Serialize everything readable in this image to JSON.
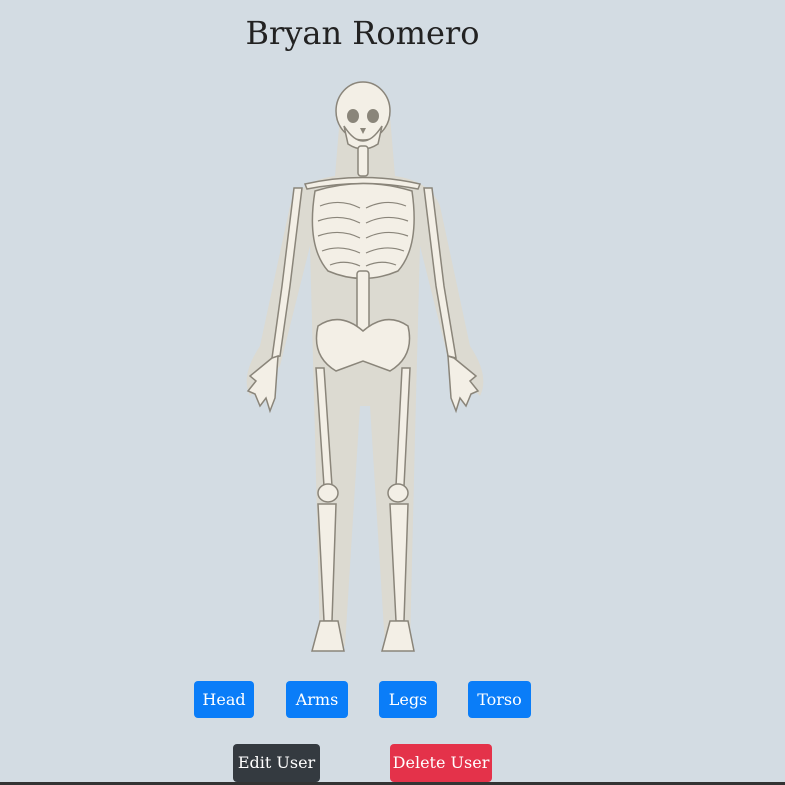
{
  "user": {
    "name": "Bryan Romero"
  },
  "body_parts": {
    "head_label": "Head",
    "arms_label": "Arms",
    "legs_label": "Legs",
    "torso_label": "Torso"
  },
  "actions": {
    "edit_label": "Edit User",
    "delete_label": "Delete User"
  },
  "colors": {
    "background": "#d3dce3",
    "primary": "#0a7df8",
    "dark": "#343a40",
    "danger": "#e4324a"
  }
}
